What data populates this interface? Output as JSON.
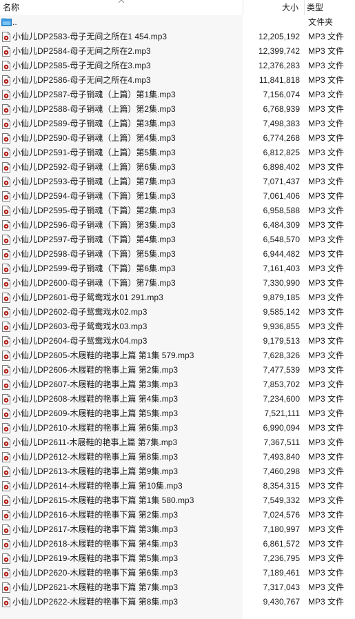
{
  "header": {
    "name": "名称",
    "size": "大小",
    "type": "类型"
  },
  "parent": {
    "name": "..",
    "type": "文件夹"
  },
  "files": [
    {
      "name": "小仙儿DP2583-母子无间之所在1 454.mp3",
      "size": "12,205,192",
      "type": "MP3 文件"
    },
    {
      "name": "小仙儿DP2584-母子无间之所在2.mp3",
      "size": "12,399,742",
      "type": "MP3 文件"
    },
    {
      "name": "小仙儿DP2585-母子无间之所在3.mp3",
      "size": "12,376,283",
      "type": "MP3 文件"
    },
    {
      "name": "小仙儿DP2586-母子无间之所在4.mp3",
      "size": "11,841,818",
      "type": "MP3 文件"
    },
    {
      "name": "小仙儿DP2587-母子销魂（上篇）第1集.mp3",
      "size": "7,156,074",
      "type": "MP3 文件"
    },
    {
      "name": "小仙儿DP2588-母子销魂（上篇）第2集.mp3",
      "size": "6,768,939",
      "type": "MP3 文件"
    },
    {
      "name": "小仙儿DP2589-母子销魂（上篇）第3集.mp3",
      "size": "7,498,383",
      "type": "MP3 文件"
    },
    {
      "name": "小仙儿DP2590-母子销魂（上篇）第4集.mp3",
      "size": "6,774,268",
      "type": "MP3 文件"
    },
    {
      "name": "小仙儿DP2591-母子销魂（上篇）第5集.mp3",
      "size": "6,812,825",
      "type": "MP3 文件"
    },
    {
      "name": "小仙儿DP2592-母子销魂（上篇）第6集.mp3",
      "size": "6,898,402",
      "type": "MP3 文件"
    },
    {
      "name": "小仙儿DP2593-母子销魂（上篇）第7集.mp3",
      "size": "7,071,437",
      "type": "MP3 文件"
    },
    {
      "name": "小仙儿DP2594-母子销魂（下篇）第1集.mp3",
      "size": "7,061,406",
      "type": "MP3 文件"
    },
    {
      "name": "小仙儿DP2595-母子销魂（下篇）第2集.mp3",
      "size": "6,958,588",
      "type": "MP3 文件"
    },
    {
      "name": "小仙儿DP2596-母子销魂（下篇）第3集.mp3",
      "size": "6,484,309",
      "type": "MP3 文件"
    },
    {
      "name": "小仙儿DP2597-母子销魂（下篇）第4集.mp3",
      "size": "6,548,570",
      "type": "MP3 文件"
    },
    {
      "name": "小仙儿DP2598-母子销魂（下篇）第5集.mp3",
      "size": "6,944,482",
      "type": "MP3 文件"
    },
    {
      "name": "小仙儿DP2599-母子销魂（下篇）第6集.mp3",
      "size": "7,161,403",
      "type": "MP3 文件"
    },
    {
      "name": "小仙儿DP2600-母子销魂（下篇）第7集.mp3",
      "size": "7,330,990",
      "type": "MP3 文件"
    },
    {
      "name": "小仙儿DP2601-母子鸳鸯戏水01 291.mp3",
      "size": "9,879,185",
      "type": "MP3 文件"
    },
    {
      "name": "小仙儿DP2602-母子鸳鸯戏水02.mp3",
      "size": "9,585,142",
      "type": "MP3 文件"
    },
    {
      "name": "小仙儿DP2603-母子鸳鸯戏水03.mp3",
      "size": "9,936,855",
      "type": "MP3 文件"
    },
    {
      "name": "小仙儿DP2604-母子鸳鸯戏水04.mp3",
      "size": "9,179,513",
      "type": "MP3 文件"
    },
    {
      "name": "小仙儿DP2605-木屐鞋的艳事上篇 第1集 579.mp3",
      "size": "7,628,326",
      "type": "MP3 文件"
    },
    {
      "name": "小仙儿DP2606-木屐鞋的艳事上篇 第2集.mp3",
      "size": "7,477,539",
      "type": "MP3 文件"
    },
    {
      "name": "小仙儿DP2607-木屐鞋的艳事上篇 第3集.mp3",
      "size": "7,853,702",
      "type": "MP3 文件"
    },
    {
      "name": "小仙儿DP2608-木屐鞋的艳事上篇 第4集.mp3",
      "size": "7,234,600",
      "type": "MP3 文件"
    },
    {
      "name": "小仙儿DP2609-木屐鞋的艳事上篇 第5集.mp3",
      "size": "7,521,111",
      "type": "MP3 文件"
    },
    {
      "name": "小仙儿DP2610-木屐鞋的艳事上篇 第6集.mp3",
      "size": "6,990,094",
      "type": "MP3 文件"
    },
    {
      "name": "小仙儿DP2611-木屐鞋的艳事上篇 第7集.mp3",
      "size": "7,367,511",
      "type": "MP3 文件"
    },
    {
      "name": "小仙儿DP2612-木屐鞋的艳事上篇 第8集.mp3",
      "size": "7,493,840",
      "type": "MP3 文件"
    },
    {
      "name": "小仙儿DP2613-木屐鞋的艳事上篇 第9集.mp3",
      "size": "7,460,298",
      "type": "MP3 文件"
    },
    {
      "name": "小仙儿DP2614-木屐鞋的艳事上篇 第10集.mp3",
      "size": "8,354,315",
      "type": "MP3 文件"
    },
    {
      "name": "小仙儿DP2615-木屐鞋的艳事下篇 第1集 580.mp3",
      "size": "7,549,332",
      "type": "MP3 文件"
    },
    {
      "name": "小仙儿DP2616-木屐鞋的艳事下篇 第2集.mp3",
      "size": "7,024,576",
      "type": "MP3 文件"
    },
    {
      "name": "小仙儿DP2617-木屐鞋的艳事下篇 第3集.mp3",
      "size": "7,180,997",
      "type": "MP3 文件"
    },
    {
      "name": "小仙儿DP2618-木屐鞋的艳事下篇 第4集.mp3",
      "size": "6,861,572",
      "type": "MP3 文件"
    },
    {
      "name": "小仙儿DP2619-木屐鞋的艳事下篇 第5集.mp3",
      "size": "7,236,795",
      "type": "MP3 文件"
    },
    {
      "name": "小仙儿DP2620-木屐鞋的艳事下篇 第6集.mp3",
      "size": "7,189,461",
      "type": "MP3 文件"
    },
    {
      "name": "小仙儿DP2621-木屐鞋的艳事下篇 第7集.mp3",
      "size": "7,317,043",
      "type": "MP3 文件"
    },
    {
      "name": "小仙儿DP2622-木屐鞋的艳事下篇 第8集.mp3",
      "size": "9,430,767",
      "type": "MP3 文件"
    }
  ]
}
